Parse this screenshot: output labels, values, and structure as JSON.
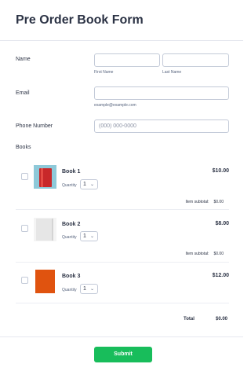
{
  "form": {
    "title": "Pre Order Book Form"
  },
  "name_field": {
    "label": "Name",
    "first_sublabel": "First Name",
    "last_sublabel": "Last Name",
    "first_value": "",
    "last_value": ""
  },
  "email_field": {
    "label": "Email",
    "sublabel": "example@example.com",
    "value": ""
  },
  "phone_field": {
    "label": "Phone Number",
    "placeholder": "(000) 000-0000"
  },
  "books": {
    "label": "Books",
    "quantity_label": "Quantity",
    "subtotal_label": "Item subtotal:",
    "items": [
      {
        "name": "Book 1",
        "price": "$10.00",
        "quantity": "1",
        "subtotal": "$0.00",
        "checked": false,
        "thumb_icon": "red-book-cover-icon",
        "thumb_color": "#c8282a"
      },
      {
        "name": "Book 2",
        "price": "$8.00",
        "quantity": "1",
        "subtotal": "$0.00",
        "checked": false,
        "thumb_icon": "white-book-cover-icon",
        "thumb_color": "#ececec"
      },
      {
        "name": "Book 3",
        "price": "$12.00",
        "quantity": "1",
        "subtotal": "",
        "checked": false,
        "thumb_icon": "orange-book-cover-icon",
        "thumb_color": "#e0530f"
      }
    ],
    "total_label": "Total",
    "total_value": "$0.00"
  },
  "submit": {
    "label": "Submit"
  },
  "colors": {
    "accent": "#18bd5b",
    "text": "#2c3345",
    "border": "#c3cad8"
  }
}
